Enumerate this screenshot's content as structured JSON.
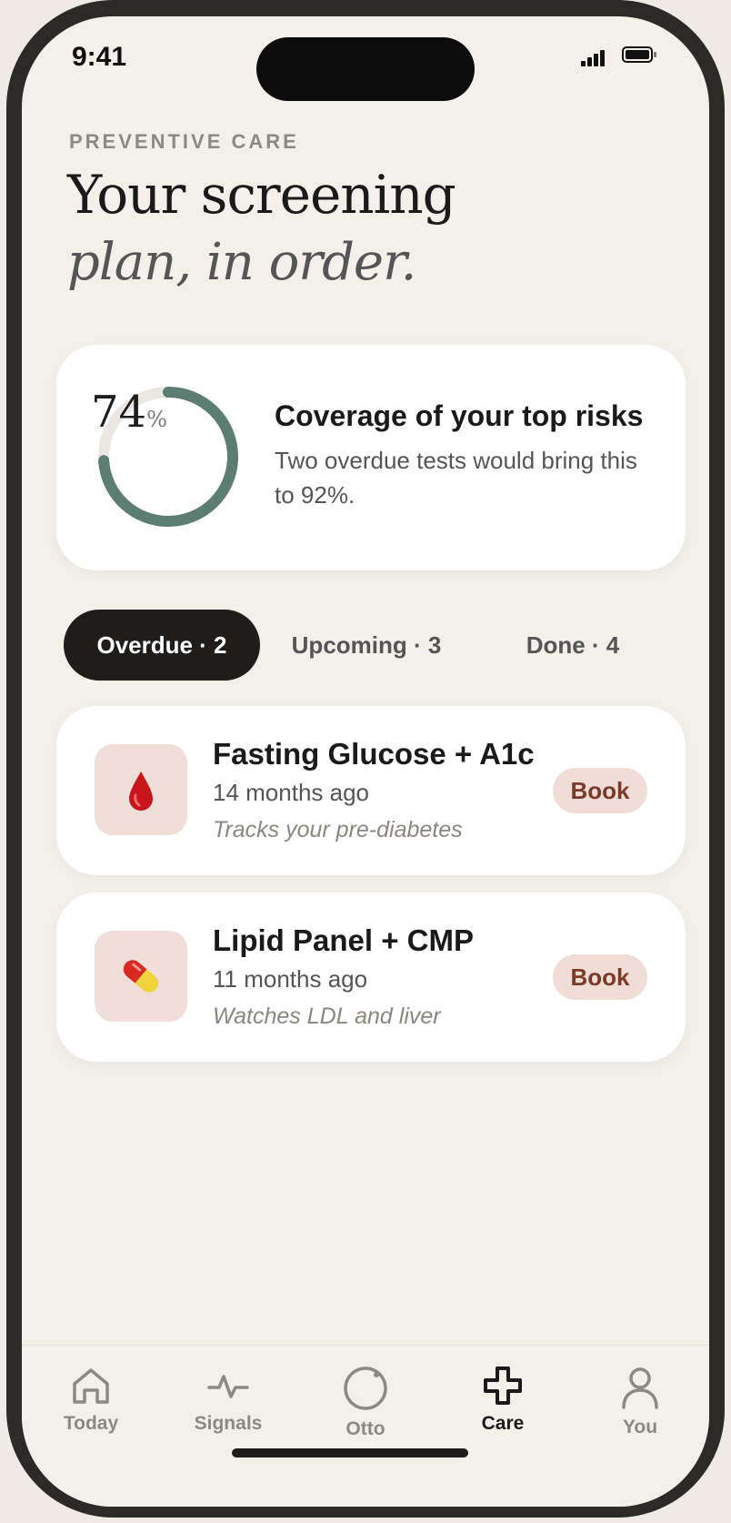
{
  "status": {
    "time": "9:41"
  },
  "header": {
    "eyebrow": "PREVENTIVE CARE",
    "title_line1": "Your screening",
    "title_line2": "plan, in order."
  },
  "coverage": {
    "percent": 74,
    "percent_text": "74",
    "percent_unit": "%",
    "title": "Coverage of your top risks",
    "subtitle": "Two overdue tests would bring this to 92%."
  },
  "filter_tabs": [
    {
      "label": "Overdue · 2",
      "active": true
    },
    {
      "label": "Upcoming · 3",
      "active": false
    },
    {
      "label": "Done · 4",
      "active": false
    }
  ],
  "tests": [
    {
      "icon": "blood-drop-icon",
      "name": "Fasting Glucose + A1c",
      "last": "14 months ago",
      "note": "Tracks your pre-diabetes",
      "action": "Book"
    },
    {
      "icon": "pill-icon",
      "name": "Lipid Panel + CMP",
      "last": "11 months ago",
      "note": "Watches LDL and liver",
      "action": "Book"
    }
  ],
  "tabbar": [
    {
      "label": "Today",
      "icon": "home-icon",
      "active": false
    },
    {
      "label": "Signals",
      "icon": "pulse-icon",
      "active": false
    },
    {
      "label": "Otto",
      "icon": "otto-icon",
      "active": false
    },
    {
      "label": "Care",
      "icon": "care-cross-icon",
      "active": true
    },
    {
      "label": "You",
      "icon": "person-icon",
      "active": false
    }
  ],
  "colors": {
    "background": "#f3efe9",
    "ring": "#5c7d72",
    "ring_track": "#ebe8e3",
    "book_bg": "#f0ddd6",
    "book_text": "#7b3b28",
    "tab_active": "#1e1d1b"
  }
}
